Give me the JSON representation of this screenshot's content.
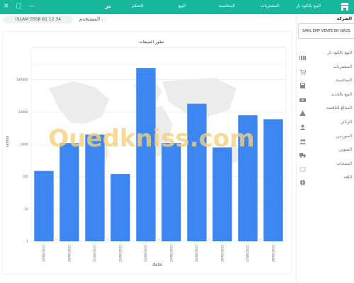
{
  "window_controls": [
    "—",
    "▢",
    "✕"
  ],
  "nav": {
    "logo": "بر",
    "items": [
      "التحكم",
      "البيع",
      "المحاسبة",
      "المشتريات",
      "البيع بالكود بار"
    ]
  },
  "user": {
    "label": "المستخدم :",
    "value": "ISLAM 0558 81 12 34"
  },
  "sidebar": {
    "company_label": "الشركة",
    "company_value": "SARL EMP VENTE EN GROS",
    "items": [
      {
        "label": "البيع بالكود بار",
        "icon": "barcode-icon"
      },
      {
        "label": "المشتريات",
        "icon": "cart-icon"
      },
      {
        "label": "المحاسبة",
        "icon": "calculator-icon"
      },
      {
        "label": "البيع بالجديد",
        "icon": "sale-icon"
      },
      {
        "label": "المبالغ الناقصة",
        "icon": "warning-icon"
      },
      {
        "label": "الزبائن",
        "icon": "user-icon"
      },
      {
        "label": "الموردين",
        "icon": "users-icon"
      },
      {
        "label": "التموين",
        "icon": "truck-icon"
      },
      {
        "label": "المنتجات",
        "icon": "box-icon"
      },
      {
        "label": "اللغة",
        "icon": "globe-icon"
      }
    ]
  },
  "watermark": "Ouedkniss.com",
  "chart_data": {
    "type": "bar",
    "title": "تطور المبيعات",
    "xlabel": "date",
    "ylabel": "ventes",
    "yscale": "log",
    "ylim": [
      1,
      1000000
    ],
    "y_ticks": [
      "1",
      "10",
      "100",
      "1000",
      "10000",
      "100000"
    ],
    "color": "#3d86f2",
    "grid": true,
    "categories": [
      "15/06/2022",
      "20/06/2022",
      "21/06/2022",
      "22/06/2022",
      "23/06/2022",
      "24/06/2022",
      "25/06/2022",
      "26/06/2022",
      "27/06/2022",
      "28/06/2022"
    ],
    "values": [
      150,
      1100,
      2000,
      120,
      230000,
      1100,
      18000,
      800,
      8000,
      6000
    ]
  }
}
